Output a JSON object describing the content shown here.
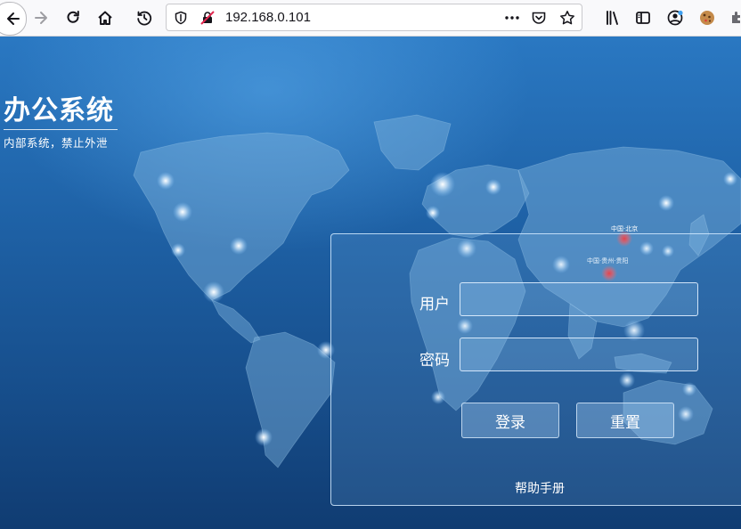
{
  "browser": {
    "url": "192.168.0.101",
    "icons": [
      "back-icon",
      "forward-icon",
      "reload-icon",
      "home-icon",
      "history-icon",
      "shield-icon",
      "insecure-lock-icon",
      "more-icon",
      "pocket-icon",
      "bookmark-star-icon",
      "library-icon",
      "sidebar-icon",
      "account-icon",
      "cookie-icon",
      "extensions-icon"
    ]
  },
  "brand": {
    "title": "办公系统",
    "subtitle": "内部系统，禁止外泄"
  },
  "map": {
    "cities": [
      {
        "label": "中国·北京"
      },
      {
        "label": "中国·贵州·贵阳"
      }
    ],
    "marker_color": "#ff2a2a"
  },
  "login": {
    "username_label": "用户",
    "username_value": "",
    "password_label": "密码",
    "password_value": "",
    "submit_label": "登录",
    "reset_label": "重置",
    "help_label": "帮助手册"
  }
}
